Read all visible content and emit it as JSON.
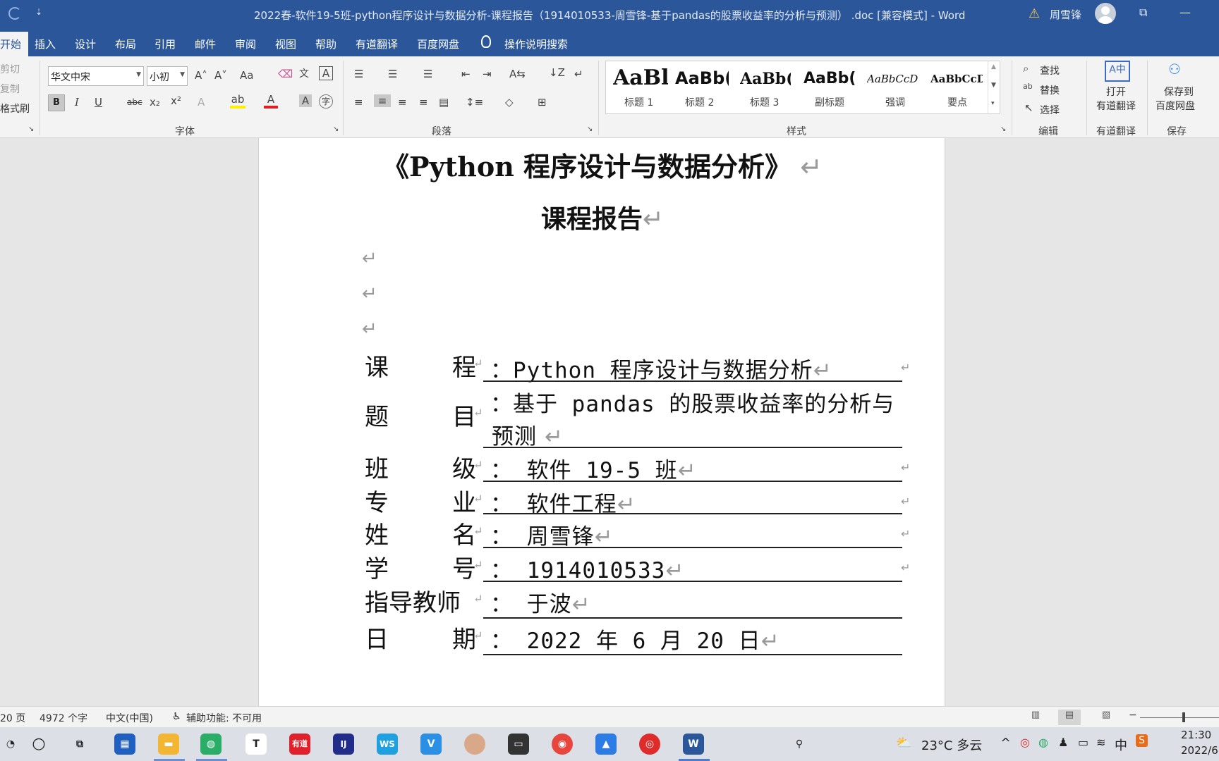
{
  "titlebar": {
    "qat": "⇣",
    "title": "2022春-软件19-5班-python程序设计与数据分析-课程报告（1914010533-周雪锋-基于pandas的股票收益率的分析与预测） .doc [兼容模式] - Word",
    "user_name": "周雪锋"
  },
  "tabs": [
    {
      "label": "开始",
      "active": true
    },
    {
      "label": "插入"
    },
    {
      "label": "设计"
    },
    {
      "label": "布局"
    },
    {
      "label": "引用"
    },
    {
      "label": "邮件"
    },
    {
      "label": "审阅"
    },
    {
      "label": "视图"
    },
    {
      "label": "帮助"
    },
    {
      "label": "有道翻译"
    },
    {
      "label": "百度网盘"
    }
  ],
  "tell_me": "操作说明搜索",
  "clipboard": {
    "cut": "剪切",
    "copy": "复制",
    "format_painter": "格式刷"
  },
  "font": {
    "name": "华文中宋",
    "size": "小初",
    "group_label": "字体"
  },
  "paragraph": {
    "group_label": "段落"
  },
  "styles": {
    "group_label": "样式",
    "items": [
      {
        "sample": "AaBl",
        "name": "标题 1"
      },
      {
        "sample": "AaBb(",
        "name": "标题 2"
      },
      {
        "sample": "AaBb(",
        "name": "标题 3"
      },
      {
        "sample": "AaBb(",
        "name": "副标题"
      },
      {
        "sample": "AaBbCcD",
        "name": "强调"
      },
      {
        "sample": "AaBbCcD",
        "name": "要点"
      }
    ]
  },
  "editing": {
    "find": "查找",
    "replace": "替换",
    "select": "选择",
    "group_label": "编辑"
  },
  "youdao": {
    "line1": "打开",
    "line2": "有道翻译",
    "group_label": "有道翻译"
  },
  "baidu": {
    "line1": "保存到",
    "line2": "百度网盘",
    "group_label": "保存"
  },
  "document": {
    "title": "《Python 程序设计与数据分析》",
    "subtitle": "课程报告",
    "rows": [
      {
        "c1": "课",
        "c2": "程",
        "value": "：Python 程序设计与数据分析"
      },
      {
        "c1": "题",
        "c2": "目",
        "value": "：基于 pandas 的股票收益率的分析与",
        "value2": "预测"
      },
      {
        "c1": "班",
        "c2": "级",
        "value": "： 软件 19-5 班"
      },
      {
        "c1": "专",
        "c2": "业",
        "value": "： 软件工程"
      },
      {
        "c1": "姓",
        "c2": "名",
        "value": "： 周雪锋"
      },
      {
        "c1": "学",
        "c2": "号",
        "value": "： 1914010533"
      },
      {
        "label": "指导教师",
        "value": "： 于波"
      },
      {
        "c1": "日",
        "c2": "期",
        "value": "： 2022 年 6 月 20 日"
      }
    ]
  },
  "statusbar": {
    "pages": "20 页",
    "words": "4972 个字",
    "language": "中文(中国)",
    "accessibility": "辅助功能: 不可用"
  },
  "taskbar": {
    "weather": "23°C  多云",
    "ime": "中",
    "time": "21:30",
    "date": "2022/6"
  }
}
